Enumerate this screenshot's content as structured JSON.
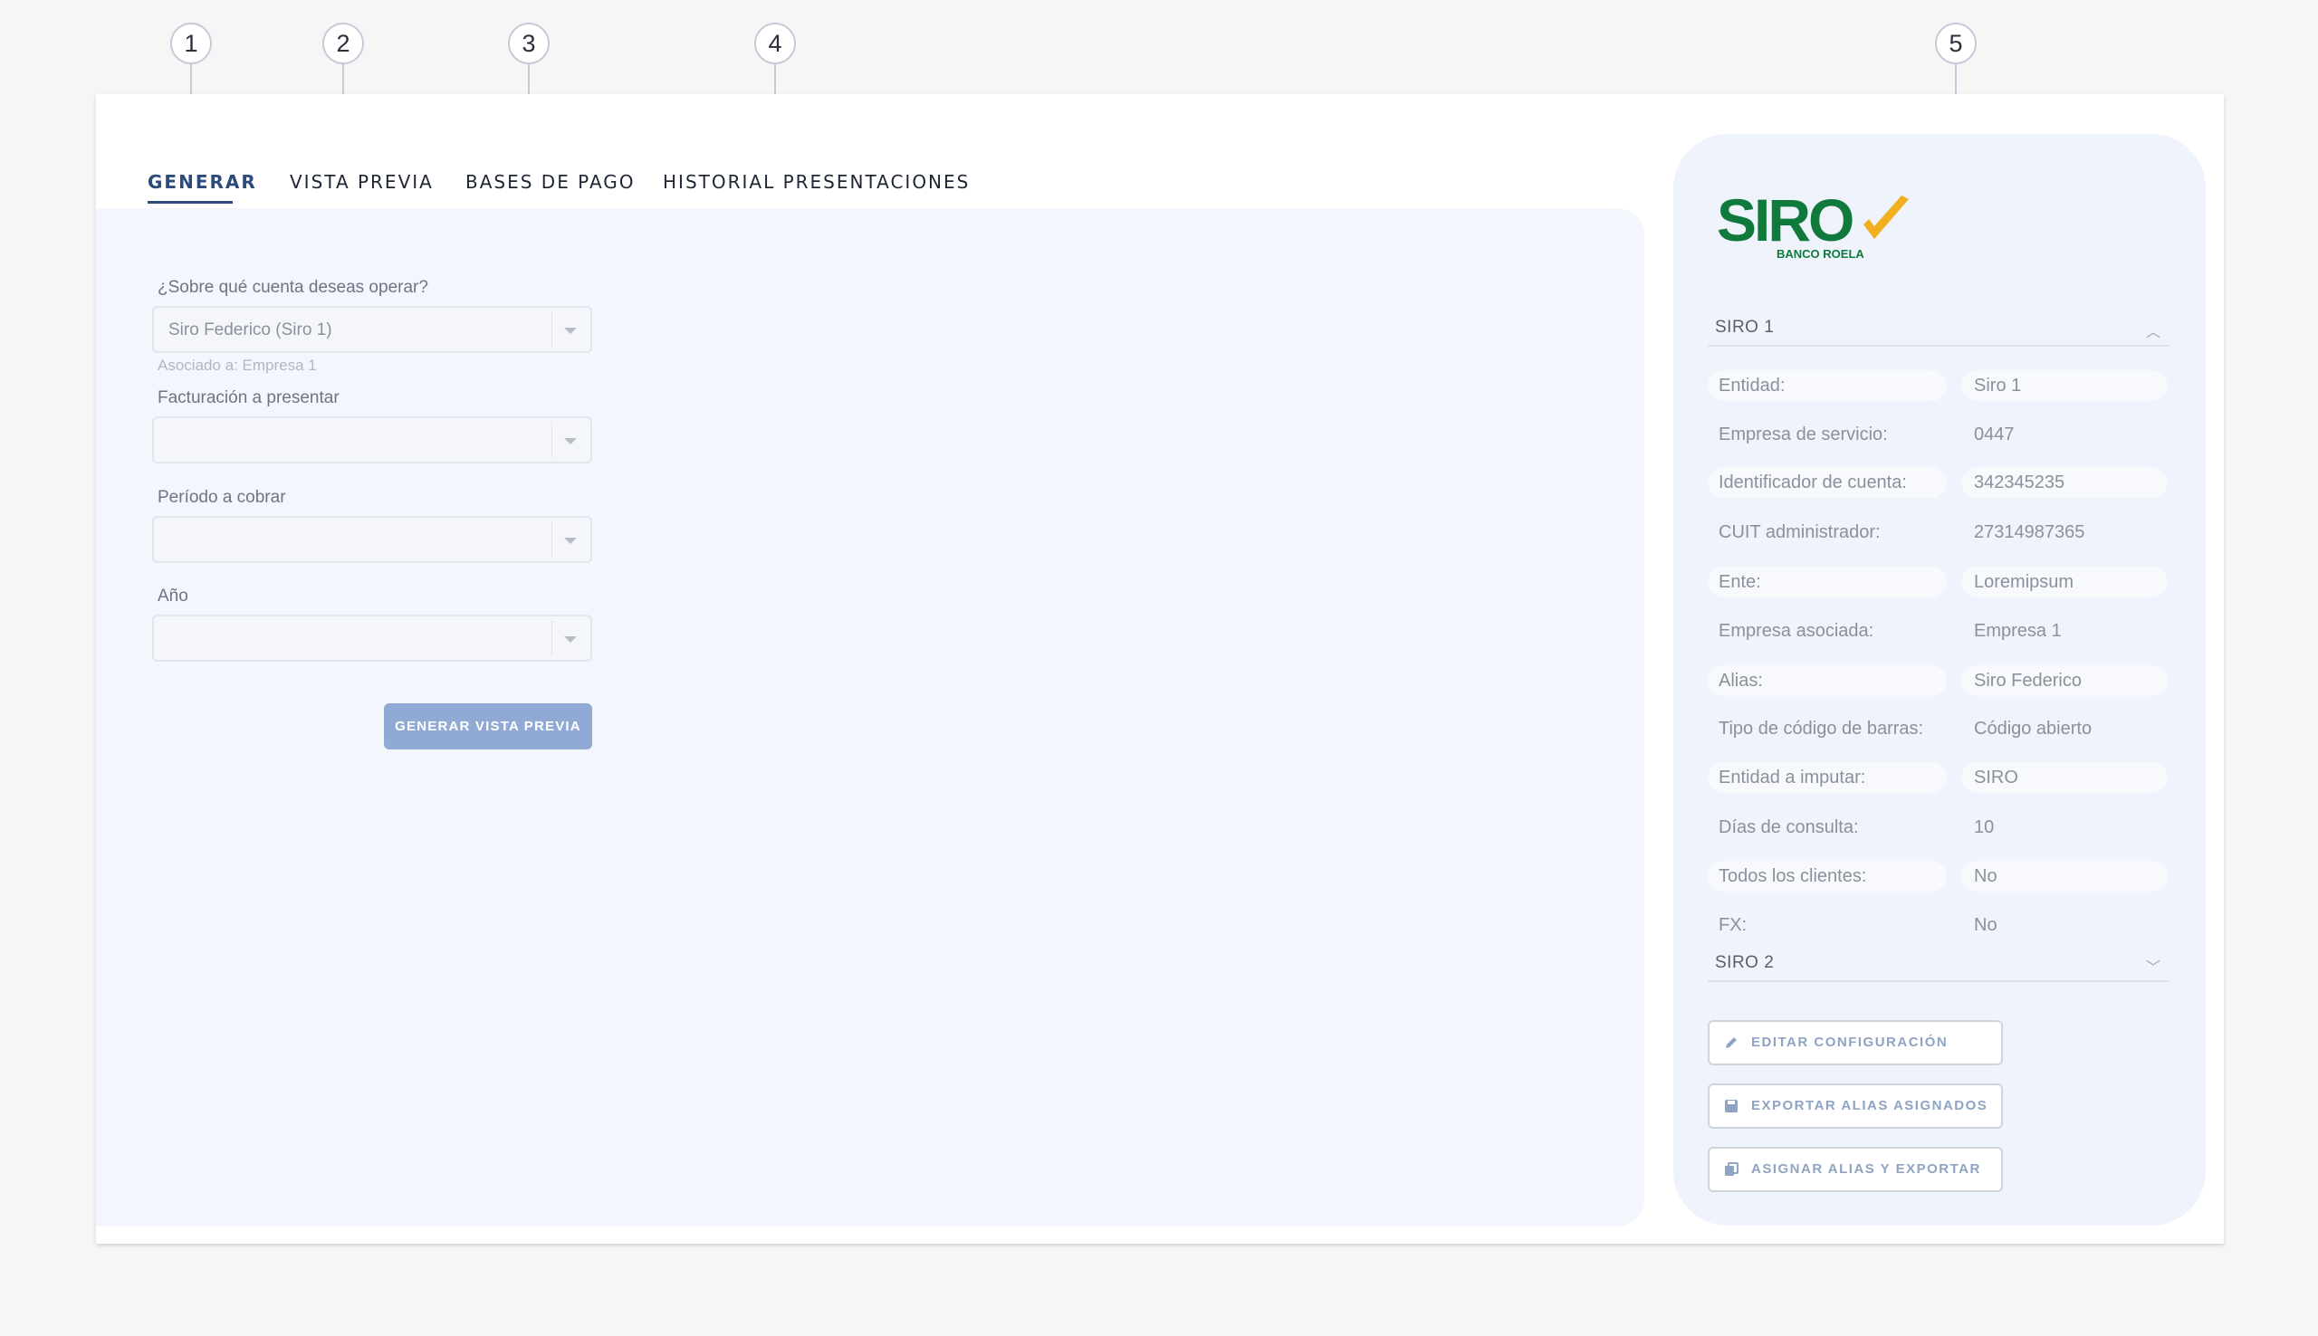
{
  "callouts": [
    "1",
    "2",
    "3",
    "4",
    "5"
  ],
  "tabs": [
    "GENERAR",
    "VISTA PREVIA",
    "BASES DE PAGO",
    "HISTORIAL PRESENTACIONES"
  ],
  "form": {
    "account_label": "¿Sobre qué cuenta deseas operar?",
    "account_value": "Siro Federico (Siro 1)",
    "account_hint": "Asociado a: Empresa 1",
    "billing_label": "Facturación a presentar",
    "billing_value": "",
    "period_label": "Período a cobrar",
    "period_value": "",
    "year_label": "Año",
    "year_value": "",
    "generate_button": "GENERAR VISTA PREVIA"
  },
  "sidebar": {
    "logo_text": "SIRO",
    "logo_subtext": "BANCO ROELA",
    "accordion1_title": "SIRO 1",
    "properties": [
      {
        "label": "Entidad:",
        "value": "Siro 1"
      },
      {
        "label": "Empresa de servicio:",
        "value": "0447"
      },
      {
        "label": "Identificador de cuenta:",
        "value": "342345235"
      },
      {
        "label": "CUIT administrador:",
        "value": "27314987365"
      },
      {
        "label": "Ente:",
        "value": "Loremipsum"
      },
      {
        "label": "Empresa asociada:",
        "value": "Empresa 1"
      },
      {
        "label": "Alias:",
        "value": "Siro Federico"
      },
      {
        "label": "Tipo de código de barras:",
        "value": "Código abierto"
      },
      {
        "label": "Entidad a imputar:",
        "value": "SIRO"
      },
      {
        "label": "Días de consulta:",
        "value": "10"
      },
      {
        "label": "Todos los clientes:",
        "value": "No"
      },
      {
        "label": "FX:",
        "value": "No"
      }
    ],
    "accordion2_title": "SIRO 2",
    "buttons": [
      "EDITAR CONFIGURACIÓN",
      "EXPORTAR ALIAS ASIGNADOS",
      "ASIGNAR ALIAS Y EXPORTAR"
    ]
  },
  "colors": {
    "accent": "#2c4a7a",
    "primary_button": "#91aad5",
    "logo_green": "#0f7a3c",
    "logo_yellow": "#f2b01e"
  }
}
